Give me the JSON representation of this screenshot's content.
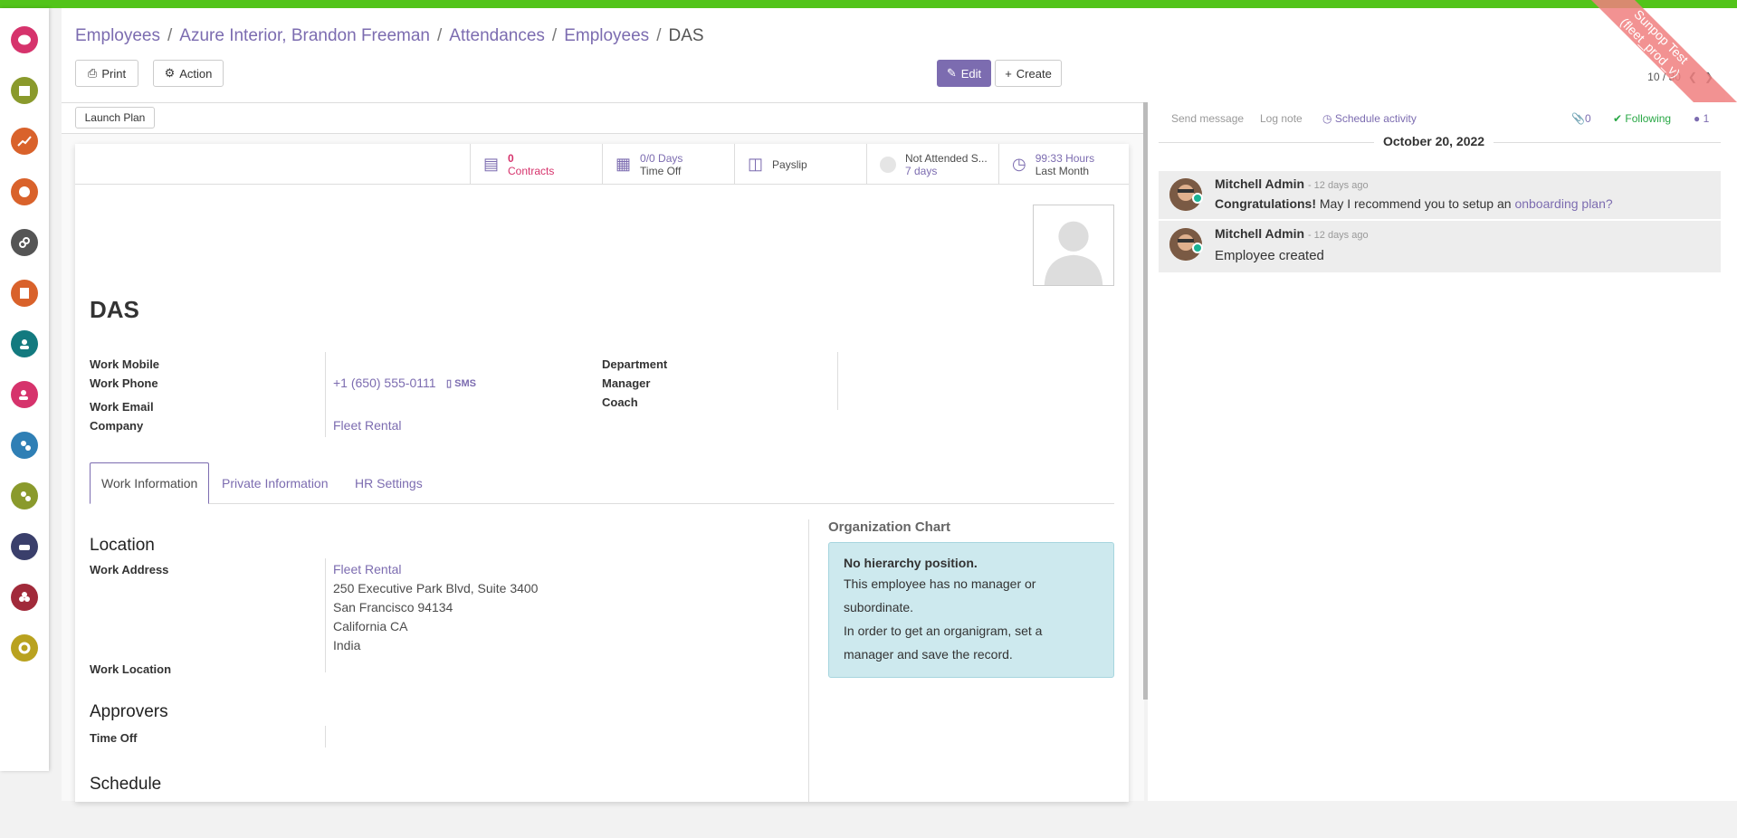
{
  "breadcrumbs": [
    "Employees",
    "Azure Interior, Brandon Freeman",
    "Attendances",
    "Employees"
  ],
  "breadcrumb_current": "DAS",
  "toolbar": {
    "print": "Print",
    "action": "Action",
    "edit": "Edit",
    "create": "Create"
  },
  "pager": {
    "value": "10 / 30"
  },
  "launch_plan": "Launch Plan",
  "smart_buttons": [
    {
      "value": "0",
      "label": "Contracts",
      "icon": "book-icon"
    },
    {
      "value": "0/0 Days",
      "label": "Time Off",
      "icon": "calendar-icon"
    },
    {
      "value": "",
      "label": "Payslip",
      "icon": "money-icon"
    },
    {
      "value": "Not Attended S...",
      "label": "7 days",
      "icon": "status-dot-icon"
    },
    {
      "value": "99:33 Hours",
      "label": "Last Month",
      "icon": "clock-icon"
    }
  ],
  "employee": {
    "name": "DAS",
    "work_mobile_label": "Work Mobile",
    "work_phone_label": "Work Phone",
    "work_phone": "+1 (650) 555-0111",
    "sms": "SMS",
    "work_email_label": "Work Email",
    "company_label": "Company",
    "company": "Fleet Rental",
    "department_label": "Department",
    "manager_label": "Manager",
    "coach_label": "Coach"
  },
  "tabs": [
    "Work Information",
    "Private Information",
    "HR Settings"
  ],
  "location": {
    "title": "Location",
    "work_address_label": "Work Address",
    "address_name": "Fleet Rental",
    "address_lines": [
      "250 Executive Park Blvd, Suite 3400",
      "San Francisco 94134",
      "California CA",
      "India"
    ],
    "work_location_label": "Work Location"
  },
  "approvers": {
    "title": "Approvers",
    "time_off_label": "Time Off"
  },
  "schedule_title": "Schedule",
  "org_chart": {
    "title": "Organization Chart",
    "heading": "No hierarchy position.",
    "lines": [
      "This employee has no manager or",
      "subordinate.",
      "In order to get an organigram, set a",
      "manager and save the record."
    ]
  },
  "chatter": {
    "send_message": "Send message",
    "log_note": "Log note",
    "schedule_activity": "Schedule activity",
    "attachments": "0",
    "following": "Following",
    "followers": "1",
    "date": "October 20, 2022",
    "messages": [
      {
        "author": "Mitchell Admin",
        "time": "- 12 days ago",
        "bold": "Congratulations!",
        "text": " May I recommend you to setup an ",
        "link": "onboarding plan?"
      },
      {
        "author": "Mitchell Admin",
        "time": "- 12 days ago",
        "text": "Employee created"
      }
    ]
  },
  "ribbon": {
    "line1": "Sunpop Test",
    "line2": "(fleet_prod_v)"
  },
  "colors": {
    "accent": "#7c6cb0",
    "topbar": "#52c41a",
    "info": "#cde9ee",
    "danger": "#d6336c"
  }
}
